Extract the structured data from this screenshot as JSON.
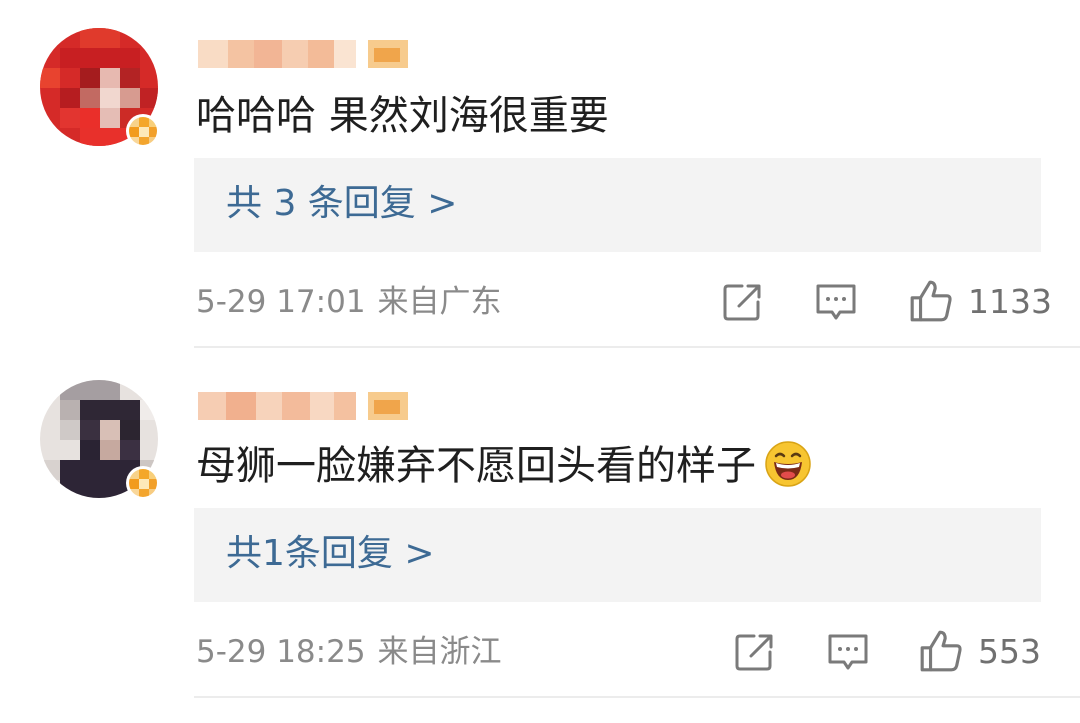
{
  "comments": [
    {
      "text": "哈哈哈 果然刘海很重要",
      "reply_link": "共 3 条回复 >",
      "time": "5-29 17:01",
      "location": "来自广东",
      "likes": "1133",
      "has_emoji": false
    },
    {
      "text": "母狮一脸嫌弃不愿回头看的样子",
      "reply_link": "共1条回复 >",
      "time": "5-29 18:25",
      "location": "来自浙江",
      "likes": "553",
      "has_emoji": true,
      "emoji": "grinning-face-emoji"
    }
  ],
  "icons": {
    "share": "share-icon",
    "comment": "comment-icon",
    "like": "thumbs-up-icon",
    "badge": "verified-badge-icon"
  },
  "colors": {
    "link": "#3d6a94",
    "meta": "#8a8a8a",
    "reply_bg": "#f3f3f3"
  }
}
